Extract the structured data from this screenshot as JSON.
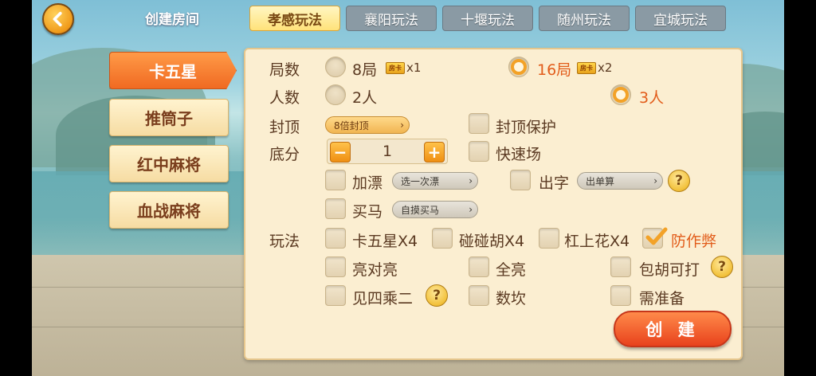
{
  "header": {
    "title": "创建房间",
    "tabs": [
      {
        "label": "孝感玩法",
        "active": true
      },
      {
        "label": "襄阳玩法",
        "active": false
      },
      {
        "label": "十堰玩法",
        "active": false
      },
      {
        "label": "随州玩法",
        "active": false
      },
      {
        "label": "宜城玩法",
        "active": false
      }
    ]
  },
  "sidebar": {
    "items": [
      {
        "label": "卡五星",
        "active": true
      },
      {
        "label": "推筒子",
        "active": false
      },
      {
        "label": "红中麻将",
        "active": false
      },
      {
        "label": "血战麻将",
        "active": false
      }
    ]
  },
  "form": {
    "rounds": {
      "label": "局数",
      "options": [
        {
          "text": "8局",
          "cost": "x1",
          "selected": false
        },
        {
          "text": "16局",
          "cost": "x2",
          "selected": true
        }
      ],
      "ticket_icon_text": "房卡"
    },
    "players": {
      "label": "人数",
      "options": [
        {
          "text": "2人",
          "selected": false
        },
        {
          "text": "3人",
          "selected": true
        }
      ]
    },
    "cap": {
      "label": "封顶",
      "dropdown": "8倍封顶",
      "protect_label": "封顶保护",
      "protect_checked": false
    },
    "base": {
      "label": "底分",
      "value": "1",
      "minus": "−",
      "plus": "+",
      "fast_label": "快速场",
      "fast_checked": false
    },
    "piao": {
      "label": "加漂",
      "dropdown": "选一次漂",
      "checked": false
    },
    "chuzi": {
      "label": "出字",
      "dropdown": "出单算",
      "checked": false
    },
    "maima": {
      "label": "买马",
      "dropdown": "自摸买马",
      "checked": false
    },
    "rules": {
      "label": "玩法",
      "items": [
        {
          "text": "卡五星X4",
          "checked": false
        },
        {
          "text": "碰碰胡X4",
          "checked": false
        },
        {
          "text": "杠上花X4",
          "checked": false
        },
        {
          "text": "防作弊",
          "checked": true
        },
        {
          "text": "亮对亮",
          "checked": false
        },
        {
          "text": "全亮",
          "checked": false
        },
        {
          "text": "包胡可打",
          "checked": false
        },
        {
          "text": "见四乘二",
          "checked": false
        },
        {
          "text": "数坎",
          "checked": false
        },
        {
          "text": "需准备",
          "checked": false
        }
      ]
    },
    "help_symbol": "?",
    "create_label": "创 建"
  },
  "colors": {
    "accent": "#f06a22",
    "check": "#f3a227",
    "panel": "#fbeed1",
    "text": "#5b3a22"
  }
}
